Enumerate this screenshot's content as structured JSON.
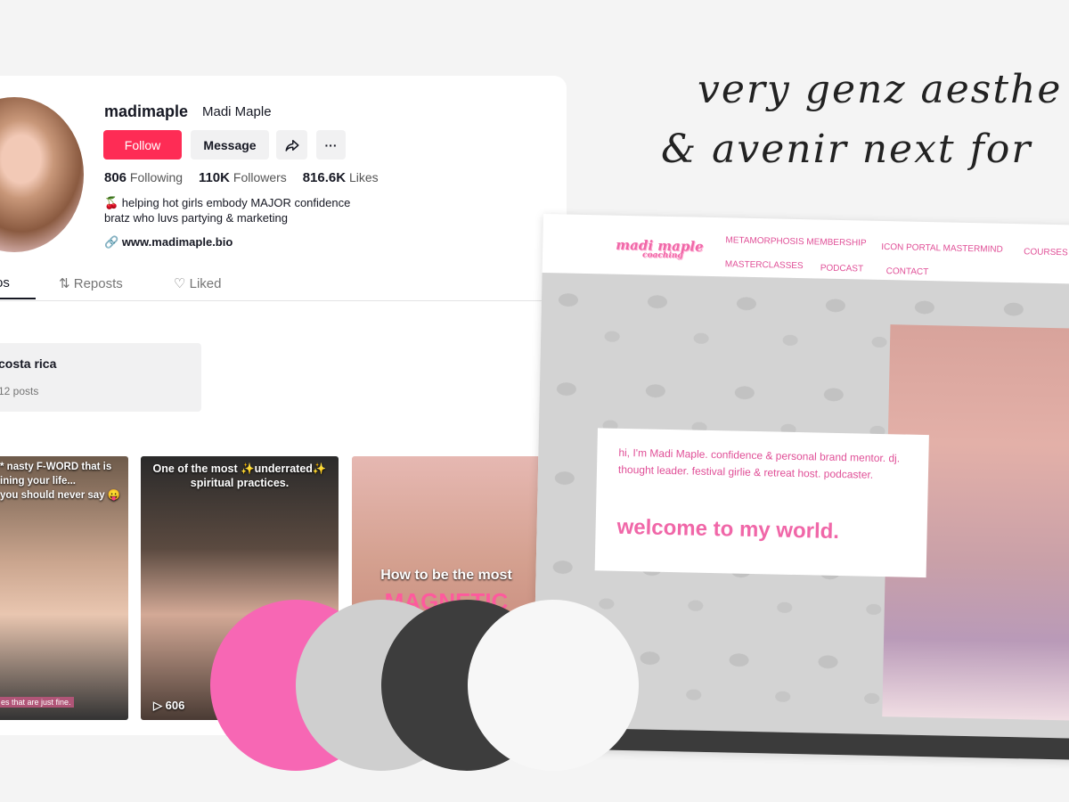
{
  "profile": {
    "handle": "madimaple",
    "display_name": "Madi Maple",
    "follow_label": "Follow",
    "message_label": "Message",
    "share_icon": "share-icon",
    "more_label": "···",
    "following_count": "806",
    "following_label": "Following",
    "followers_count": "110K",
    "followers_label": "Followers",
    "likes_count": "816.6K",
    "likes_label": "Likes",
    "bio_line1": "🍒 helping hot girls embody MAJOR confidence",
    "bio_line2": "bratz who luvs partying & marketing",
    "link": "www.madimaple.bio",
    "tabs": [
      "os",
      "Reposts",
      "Liked"
    ],
    "collection": {
      "title": "costa rica",
      "count": "12 posts"
    },
    "videos": [
      {
        "caption": "* nasty F-WORD that is\nining your life...\nyou should never say 😛",
        "subline": "es that are just fine."
      },
      {
        "caption": "One of the most ✨underrated✨\nspiritual practices.",
        "plays": "606"
      },
      {
        "caption": "How to be the most",
        "highlight": "MAGNETIC"
      }
    ]
  },
  "headline": {
    "line1": "very genz aesthe",
    "line2": "& avenir next for"
  },
  "website": {
    "logo": "madi maple",
    "logo_sub": "coaching",
    "nav": [
      "METAMORPHOSIS MEMBERSHIP",
      "ICON PORTAL MASTERMIND",
      "COURSES",
      "MASTERCLASSES",
      "PODCAST",
      "CONTACT"
    ],
    "intro": "hi, I'm Madi Maple. confidence & personal brand mentor. dj. thought leader. festival girlie & retreat host. podcaster.",
    "welcome": "welcome to my world."
  },
  "palette": {
    "colors": [
      "#f767b4",
      "#cfcfcf",
      "#3d3d3d",
      "#f7f7f7"
    ]
  }
}
